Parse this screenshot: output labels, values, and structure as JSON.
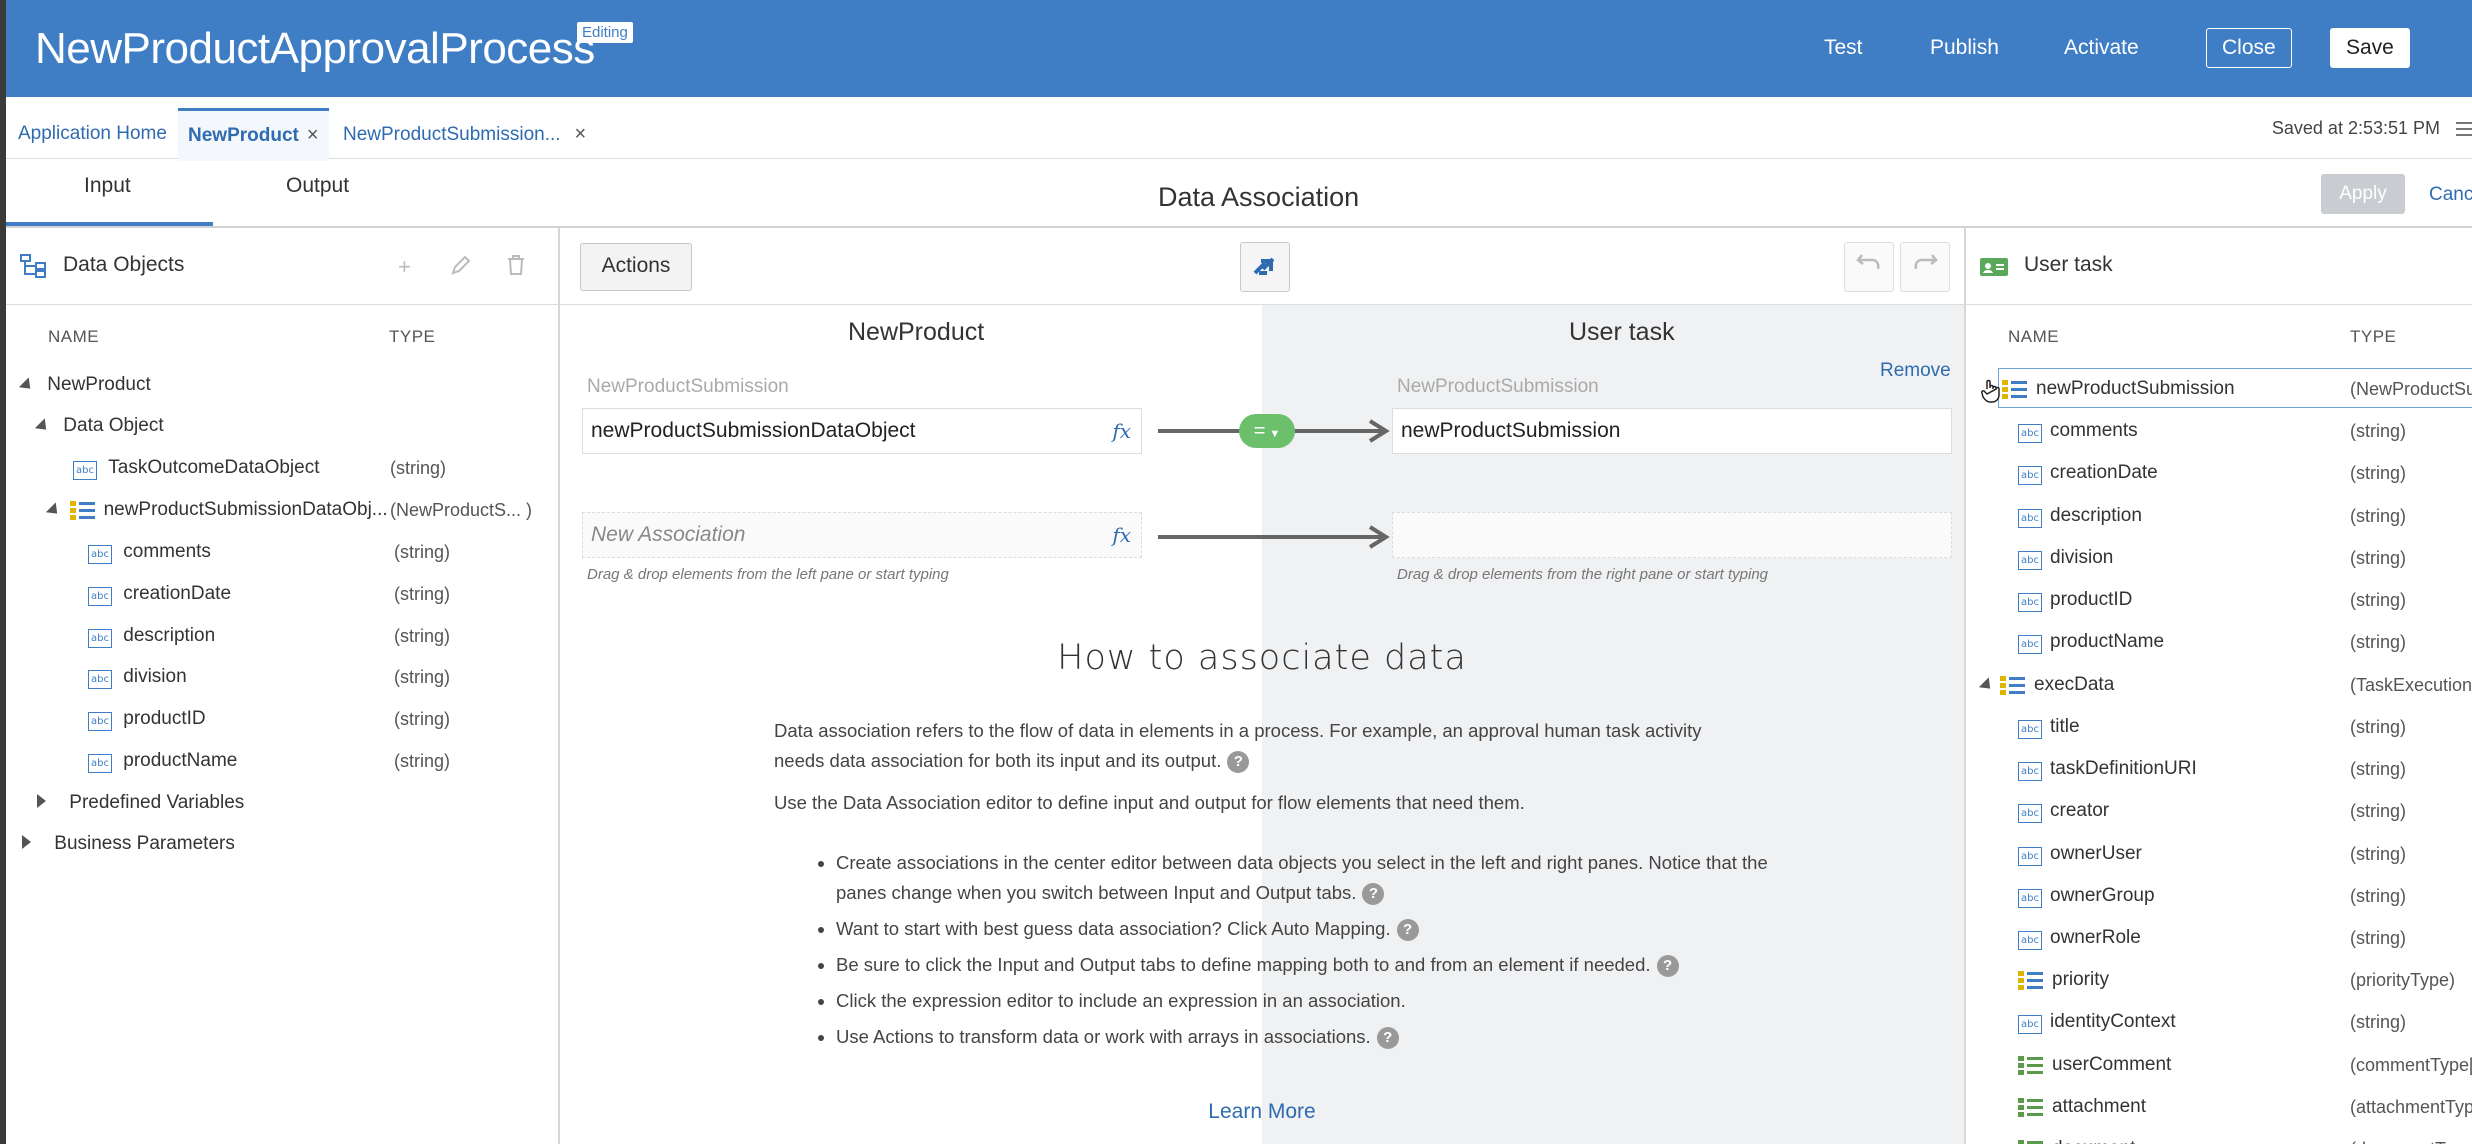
{
  "header": {
    "title": "NewProductApprovalProcess",
    "badge": "Editing",
    "links": [
      "Test",
      "Publish",
      "Activate"
    ],
    "close_label": "Close",
    "save_label": "Save"
  },
  "tabs": {
    "items": [
      {
        "label": "Application Home",
        "closable": false
      },
      {
        "label": "NewProduct",
        "closable": true,
        "active": true
      },
      {
        "label": "NewProductSubmission...",
        "closable": true
      }
    ],
    "saved_at": "Saved at 2:53:51 PM"
  },
  "subtabs": {
    "input": "Input",
    "output": "Output",
    "title": "Data Association",
    "apply": "Apply",
    "cancel": "Canc"
  },
  "left_pane": {
    "title": "Data Objects",
    "col_name": "NAME",
    "col_type": "TYPE",
    "rows": [
      {
        "label": "NewProduct",
        "type": "",
        "icon": "none",
        "expander": "down"
      },
      {
        "label": "Data Object",
        "type": "",
        "icon": "none",
        "expander": "down"
      },
      {
        "label": "TaskOutcomeDataObject",
        "type": "(string)",
        "icon": "abc",
        "expander": "none"
      },
      {
        "label": "newProductSubmissionDataObj...",
        "type": "(NewProductS... )",
        "icon": "struct",
        "expander": "down"
      },
      {
        "label": "comments",
        "type": "(string)",
        "icon": "abc",
        "expander": "none"
      },
      {
        "label": "creationDate",
        "type": "(string)",
        "icon": "abc",
        "expander": "none"
      },
      {
        "label": "description",
        "type": "(string)",
        "icon": "abc",
        "expander": "none"
      },
      {
        "label": "division",
        "type": "(string)",
        "icon": "abc",
        "expander": "none"
      },
      {
        "label": "productID",
        "type": "(string)",
        "icon": "abc",
        "expander": "none"
      },
      {
        "label": "productName",
        "type": "(string)",
        "icon": "abc",
        "expander": "none"
      },
      {
        "label": "Predefined Variables",
        "type": "",
        "icon": "none",
        "expander": "right"
      },
      {
        "label": "Business Parameters",
        "type": "",
        "icon": "none",
        "expander": "right"
      }
    ]
  },
  "center": {
    "actions_label": "Actions",
    "left_title": "NewProduct",
    "right_title": "User task",
    "remove_label": "Remove",
    "source_label": "NewProductSubmission",
    "target_label": "NewProductSubmission",
    "source_value": "newProductSubmissionDataObject",
    "target_value": "newProductSubmission",
    "new_assoc_placeholder": "New Association",
    "fx": "fx",
    "connector": "=",
    "hint_left": "Drag & drop elements from the left pane or start typing",
    "hint_right": "Drag & drop elements from the right pane or start typing",
    "howto_title": "How to associate data",
    "para1": "Data association refers to the flow of data in elements in a process. For example, an approval human task activity needs data association for both its input and its output.",
    "para2": "Use the Data Association editor to define input and output for flow elements that need them.",
    "bullets": [
      "Create associations in the center editor between data objects you select in the left and right panes. Notice that the panes change when you switch between Input and Output tabs.",
      "Want to start with best guess data association? Click Auto Mapping.",
      "Be sure to click the Input and Output tabs to define mapping both to and from an element if needed.",
      "Click the expression editor to include an expression in an association.",
      "Use Actions to transform data or work with arrays in associations."
    ],
    "learn_more": "Learn More"
  },
  "right_pane": {
    "title": "User task",
    "col_name": "NAME",
    "col_type": "TYPE",
    "rows": [
      {
        "label": "newProductSubmission",
        "type": "(NewProductSu...",
        "icon": "struct"
      },
      {
        "label": "comments",
        "type": "(string)",
        "icon": "abc"
      },
      {
        "label": "creationDate",
        "type": "(string)",
        "icon": "abc"
      },
      {
        "label": "description",
        "type": "(string)",
        "icon": "abc"
      },
      {
        "label": "division",
        "type": "(string)",
        "icon": "abc"
      },
      {
        "label": "productID",
        "type": "(string)",
        "icon": "abc"
      },
      {
        "label": "productName",
        "type": "(string)",
        "icon": "abc"
      },
      {
        "label": "execData",
        "type": "(TaskExecution...",
        "icon": "struct"
      },
      {
        "label": "title",
        "type": "(string)",
        "icon": "abc"
      },
      {
        "label": "taskDefinitionURI",
        "type": "(string)",
        "icon": "abc"
      },
      {
        "label": "creator",
        "type": "(string)",
        "icon": "abc"
      },
      {
        "label": "ownerUser",
        "type": "(string)",
        "icon": "abc"
      },
      {
        "label": "ownerGroup",
        "type": "(string)",
        "icon": "abc"
      },
      {
        "label": "ownerRole",
        "type": "(string)",
        "icon": "abc"
      },
      {
        "label": "priority",
        "type": "(priorityType)",
        "icon": "struct"
      },
      {
        "label": "identityContext",
        "type": "(string)",
        "icon": "abc"
      },
      {
        "label": "userComment",
        "type": "(commentType[]",
        "icon": "struct-green"
      },
      {
        "label": "attachment",
        "type": "(attachmentType",
        "icon": "struct-green"
      },
      {
        "label": "document",
        "type": "(documentType",
        "icon": "struct-green"
      }
    ]
  },
  "colors": {
    "header_bg": "#3f7ec4",
    "link": "#2f6bb0",
    "connector_green": "#6cc06b"
  }
}
